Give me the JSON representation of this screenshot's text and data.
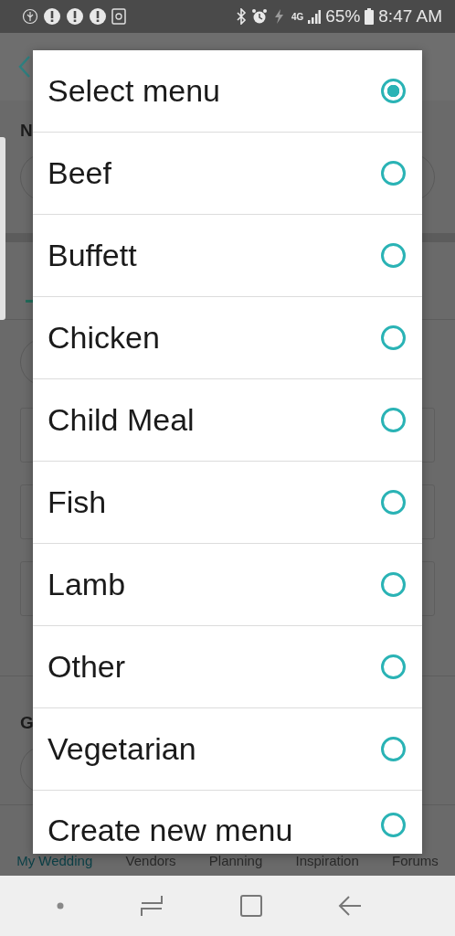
{
  "status_bar": {
    "network_label": "4G",
    "battery": "65%",
    "time": "8:47 AM"
  },
  "background": {
    "section_letter": "N",
    "group_letter": "G"
  },
  "bottom_nav": [
    {
      "label": "My Wedding",
      "selected": true
    },
    {
      "label": "Vendors",
      "selected": false
    },
    {
      "label": "Planning",
      "selected": false
    },
    {
      "label": "Inspiration",
      "selected": false
    },
    {
      "label": "Forums",
      "selected": false
    }
  ],
  "dialog": {
    "options": [
      {
        "label": "Select menu",
        "selected": true
      },
      {
        "label": "Beef",
        "selected": false
      },
      {
        "label": "Buffett",
        "selected": false
      },
      {
        "label": "Chicken",
        "selected": false
      },
      {
        "label": "Child Meal",
        "selected": false
      },
      {
        "label": "Fish",
        "selected": false
      },
      {
        "label": "Lamb",
        "selected": false
      },
      {
        "label": "Other",
        "selected": false
      },
      {
        "label": "Vegetarian",
        "selected": false
      },
      {
        "label": "Create new menu",
        "selected": false
      }
    ]
  }
}
